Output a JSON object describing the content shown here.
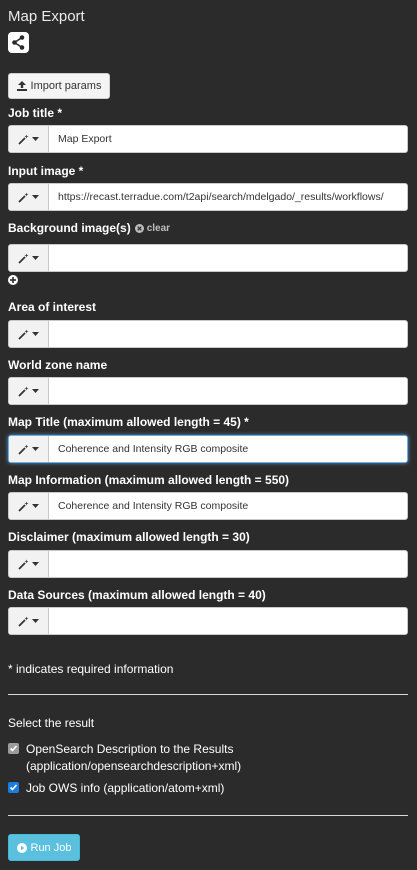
{
  "page": {
    "title": "Map Export"
  },
  "toolbar": {
    "import_label": "Import params"
  },
  "fields": {
    "job_title": {
      "label": "Job title *",
      "value": "Map Export"
    },
    "input_image": {
      "label": "Input image *",
      "value": "https://recast.terradue.com/t2api/search/mdelgado/_results/workflows/"
    },
    "background_images": {
      "label": "Background image(s)",
      "clear_label": "clear",
      "value": ""
    },
    "area_of_interest": {
      "label": "Area of interest",
      "value": ""
    },
    "world_zone_name": {
      "label": "World zone name",
      "value": ""
    },
    "map_title": {
      "label": "Map Title (maximum allowed length = 45) *",
      "value": "Coherence and Intensity RGB composite"
    },
    "map_information": {
      "label": "Map Information (maximum allowed length = 550)",
      "value": "Coherence and Intensity RGB composite"
    },
    "disclaimer": {
      "label": "Disclaimer (maximum allowed length = 30)",
      "value": ""
    },
    "data_sources": {
      "label": "Data Sources (maximum allowed length = 40)",
      "value": ""
    }
  },
  "required_note": "* indicates required information",
  "results": {
    "label": "Select the result",
    "options": [
      {
        "line1": "OpenSearch Description to the Results",
        "line2": "(application/opensearchdescription+xml)",
        "checked": true,
        "disabled": true
      },
      {
        "line1": "Job OWS info (application/atom+xml)",
        "checked": true,
        "disabled": false
      }
    ]
  },
  "run_label": "Run Job",
  "colors": {
    "background": "#2b2b2b",
    "run_button": "#5bc0de",
    "focus": "#66afe9",
    "checkbox": "#1c7ce0"
  },
  "icons": [
    "share-icon",
    "upload-icon",
    "magic-wand-icon",
    "caret-down-icon",
    "times-circle-icon",
    "plus-circle-icon",
    "play-circle-icon",
    "checkmark-icon"
  ]
}
